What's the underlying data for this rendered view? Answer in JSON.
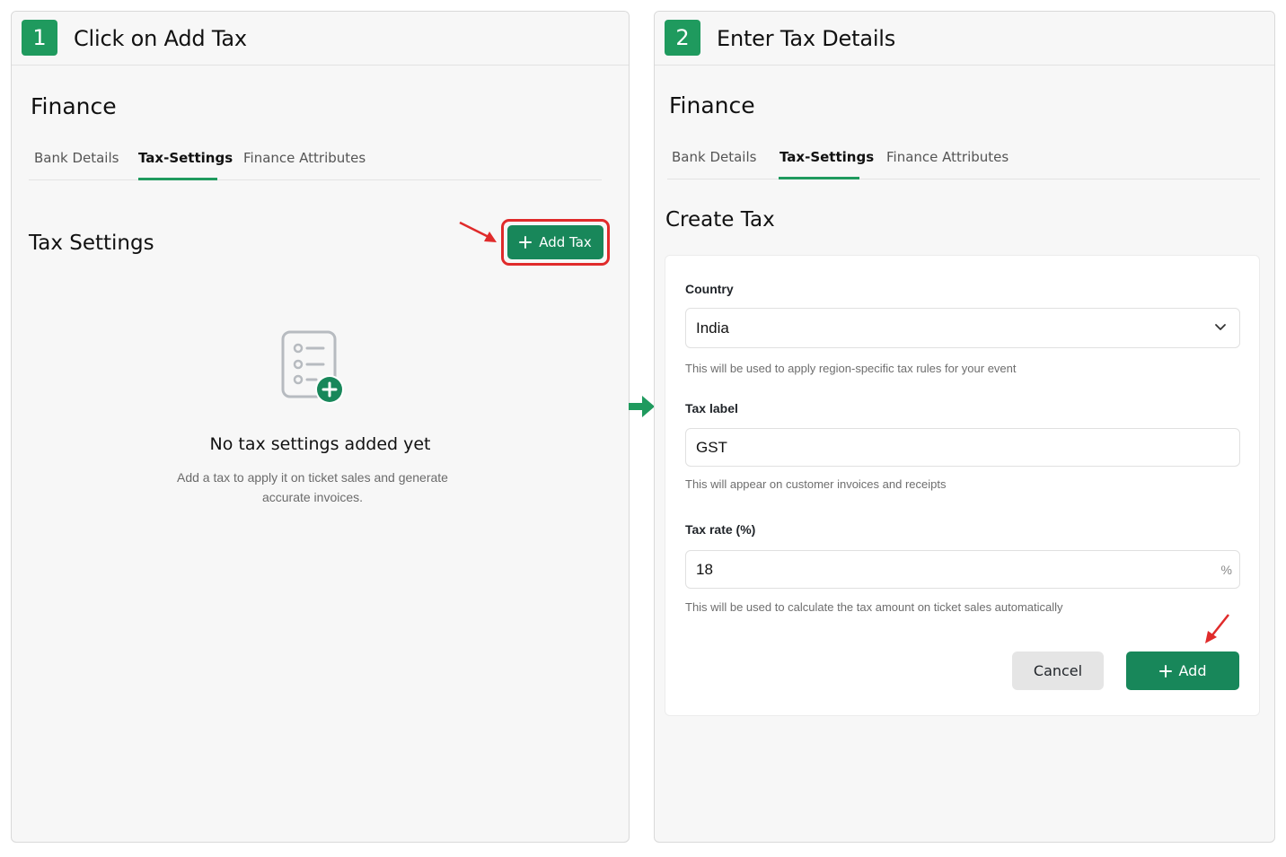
{
  "step1": {
    "number": "1",
    "title": "Click on Add Tax",
    "page_title": "Finance",
    "tabs": [
      "Bank Details",
      "Tax-Settings",
      "Finance Attributes"
    ],
    "active_tab": "Tax-Settings",
    "section_title": "Tax Settings",
    "add_button_label": "Add Tax",
    "empty_title": "No tax settings added yet",
    "empty_description": "Add a tax to apply it on ticket sales and generate accurate invoices."
  },
  "step2": {
    "number": "2",
    "title": "Enter Tax Details",
    "page_title": "Finance",
    "tabs": [
      "Bank Details",
      "Tax-Settings",
      "Finance Attributes"
    ],
    "active_tab": "Tax-Settings",
    "form_title": "Create Tax",
    "country": {
      "label": "Country",
      "value": "India",
      "help": "This will be used to apply region-specific tax rules for your event"
    },
    "tax_label": {
      "label": "Tax label",
      "value": "GST",
      "help": "This will appear on customer invoices and receipts"
    },
    "tax_rate": {
      "label": "Tax rate (%)",
      "value": "18",
      "suffix": "%",
      "help": "This will be used to calculate the tax amount on ticket sales automatically"
    },
    "cancel_label": "Cancel",
    "add_label": "Add"
  },
  "colors": {
    "accent_green": "#18875a",
    "badge_green": "#1f9a5e",
    "highlight_red": "#e02b2b"
  },
  "icons": [
    "plus-icon",
    "empty-list-icon",
    "chevron-down-icon",
    "red-pointer-arrow-icon",
    "flow-arrow-icon"
  ]
}
